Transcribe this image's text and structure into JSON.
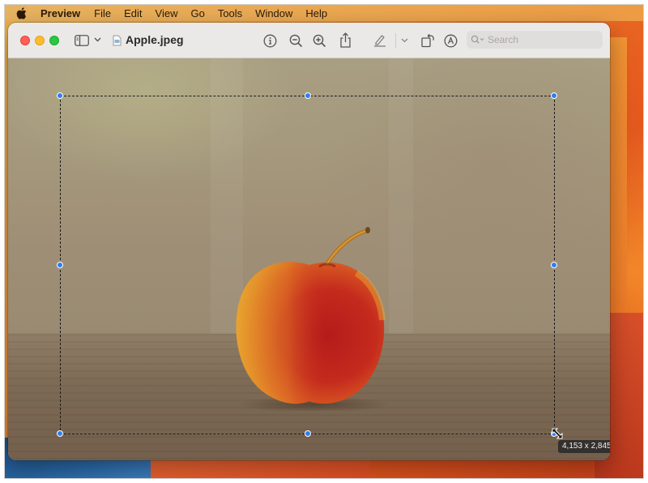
{
  "menubar": {
    "apple_icon": "apple-logo-icon",
    "app_name": "Preview",
    "items": [
      "File",
      "Edit",
      "View",
      "Go",
      "Tools",
      "Window",
      "Help"
    ]
  },
  "window": {
    "document_title": "Apple.jpeg",
    "toolbar": {
      "icons": [
        "sidebar-toggle-icon",
        "chevron-down-icon",
        "document-icon",
        "info-icon",
        "zoom-out-icon",
        "zoom-in-icon",
        "share-icon",
        "highlight-icon",
        "chevron-down-icon",
        "rotate-icon",
        "markup-icon",
        "search-icon"
      ],
      "search_placeholder": "Search"
    },
    "traffic_lights": {
      "close_color": "#fe5f57",
      "minimize_color": "#febc2e",
      "zoom_color": "#28c840"
    }
  },
  "selection": {
    "size_readout": "4,153 x 2,845",
    "handle_color": "#2f7ef1"
  },
  "image": {
    "subject": "red-yellow apple on wooden table"
  }
}
